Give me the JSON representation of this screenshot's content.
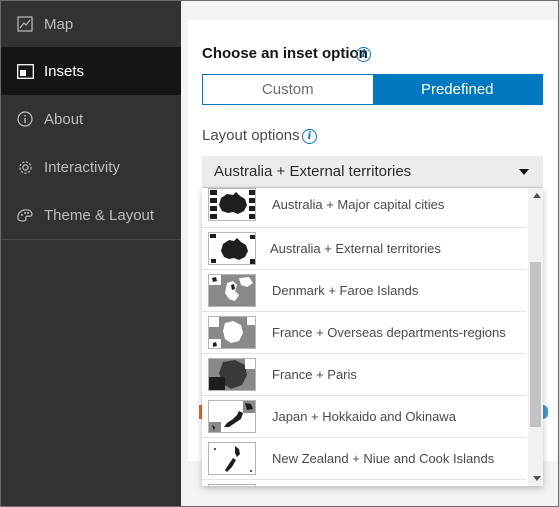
{
  "sidebar": {
    "items": [
      {
        "label": "Map",
        "icon": "map-icon",
        "active": false
      },
      {
        "label": "Insets",
        "icon": "insets-icon",
        "active": true
      },
      {
        "label": "About",
        "icon": "info-icon",
        "active": false
      },
      {
        "label": "Interactivity",
        "icon": "gear-icon",
        "active": false
      },
      {
        "label": "Theme & Layout",
        "icon": "palette-icon",
        "active": false
      }
    ]
  },
  "inset": {
    "title": "Choose an inset option",
    "options": [
      "Custom",
      "Predefined"
    ],
    "selected_option": "Predefined"
  },
  "layout": {
    "label": "Layout options",
    "selected": "Australia + External territories",
    "items": [
      "Australia + Major capital cities",
      "Australia + External territories",
      "Denmark + Faroe Islands",
      "France + Overseas departments-regions",
      "France + Paris",
      "Japan + Hokkaido and Okinawa",
      "New Zealand + Niue and Cook Islands"
    ]
  },
  "colors": {
    "accent": "#0079c1",
    "sidebar_bg": "#323232",
    "sidebar_active": "#151515"
  }
}
